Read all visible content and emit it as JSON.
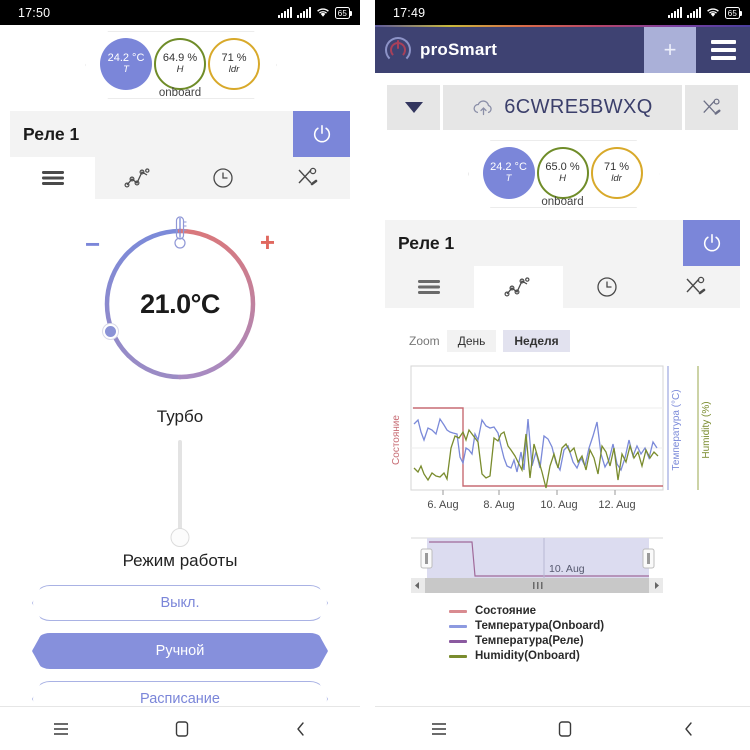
{
  "left": {
    "status": {
      "time": "17:50",
      "battery": "65",
      "signal_icon": "signal-bars-icon",
      "wifi_icon": "wifi-icon",
      "battery_icon": "battery-icon"
    },
    "gauges": {
      "caption": "onboard",
      "items": [
        {
          "value": "24.2 °C",
          "unit": "T",
          "style": "temperature",
          "color": "#7b86d9"
        },
        {
          "value": "64.9 %",
          "unit": "H",
          "style": "humidity",
          "color": "#6f8c28"
        },
        {
          "value": "71 %",
          "unit": "ldr",
          "style": "light",
          "color": "#d8a92a"
        }
      ]
    },
    "relay": {
      "title": "Реле 1",
      "power_icon": "power-icon",
      "power_color": "#7b86d9",
      "tabs": [
        {
          "icon": "sliders-icon",
          "active": true
        },
        {
          "icon": "chart-line-icon",
          "active": false
        },
        {
          "icon": "clock-icon",
          "active": false
        },
        {
          "icon": "tools-icon",
          "active": false
        }
      ]
    },
    "dial": {
      "value": "21.0°C",
      "minus_label": "−",
      "plus_label": "+",
      "thermometer_icon": "thermometer-icon",
      "cold_color": "#7b86d9",
      "hot_color": "#d9787c"
    },
    "turbo": {
      "label": "Турбо",
      "position_percent": 0
    },
    "mode": {
      "label": "Режим работы",
      "buttons": [
        {
          "label": "Выкл.",
          "active": false
        },
        {
          "label": "Ручной",
          "active": true
        },
        {
          "label": "Расписание",
          "active": false
        }
      ]
    },
    "navbar": {
      "recents_icon": "recents-icon",
      "home_icon": "home-icon",
      "back_icon": "back-icon"
    }
  },
  "right": {
    "status": {
      "time": "17:49",
      "battery": "65",
      "signal_icon": "signal-bars-icon",
      "wifi_icon": "wifi-icon",
      "battery_icon": "battery-icon"
    },
    "appbar": {
      "brand": "proSmart",
      "logo_icon": "prosmart-logo-icon",
      "add_label": "+",
      "menu_icon": "hamburger-menu-icon",
      "bg_color": "#3e4272",
      "add_bg_color": "#aab0d8"
    },
    "device": {
      "dropdown_icon": "chevron-down-icon",
      "cloud_icon": "cloud-upload-icon",
      "id": "6CWRE5BWXQ",
      "tools_icon": "tools-icon"
    },
    "gauges": {
      "caption": "onboard",
      "items": [
        {
          "value": "24.2 °C",
          "unit": "T",
          "style": "temperature",
          "color": "#7b86d9"
        },
        {
          "value": "65.0 %",
          "unit": "H",
          "style": "humidity",
          "color": "#6f8c28"
        },
        {
          "value": "71 %",
          "unit": "ldr",
          "style": "light",
          "color": "#d8a92a"
        }
      ]
    },
    "relay": {
      "title": "Реле 1",
      "power_icon": "power-icon",
      "power_color": "#7b86d9",
      "tabs": [
        {
          "icon": "sliders-icon",
          "active": false
        },
        {
          "icon": "chart-line-icon",
          "active": true
        },
        {
          "icon": "clock-icon",
          "active": false
        },
        {
          "icon": "tools-icon",
          "active": false
        }
      ]
    },
    "navbar": {
      "recents_icon": "recents-icon",
      "home_icon": "home-icon",
      "back_icon": "back-icon"
    }
  },
  "chart_data": {
    "type": "line",
    "title": "",
    "zoom_label": "Zoom",
    "zoom_buttons": [
      {
        "label": "День",
        "active": false
      },
      {
        "label": "Неделя",
        "active": true
      }
    ],
    "xlabel": "",
    "x_tick_labels": [
      "6. Aug",
      "8. Aug",
      "10. Aug",
      "12. Aug"
    ],
    "y_axes": [
      {
        "name": "Состояние",
        "position": "left",
        "color": "#c76b73"
      },
      {
        "name": "Температура (°C)",
        "position": "right",
        "color": "#7b8ad9"
      },
      {
        "name": "Humidity (%)",
        "position": "right-outer",
        "color": "#7a8c2e"
      }
    ],
    "grid": true,
    "legend_position": "bottom",
    "navigator": {
      "visible": true,
      "label": "10. Aug",
      "scroll_left_icon": "arrow-left-icon",
      "scroll_right_icon": "arrow-right-icon",
      "grip_icon": "grip-icon"
    },
    "series": [
      {
        "name": "Состояние",
        "color": "#c76b73",
        "type": "step",
        "values": [
          1,
          1,
          1,
          1,
          1,
          1,
          1,
          1,
          0,
          0,
          0,
          0,
          0,
          0,
          0,
          0,
          0,
          0,
          0,
          0,
          0,
          0,
          0,
          0,
          0,
          0,
          0,
          0,
          0,
          0,
          0,
          0,
          0,
          0,
          0,
          0,
          0,
          0,
          0,
          0
        ]
      },
      {
        "name": "Температура(Onboard)",
        "color": "#7b8ad9",
        "type": "line",
        "values": [
          26.0,
          25.0,
          23.2,
          22.4,
          24.5,
          24.0,
          23.6,
          26.5,
          25.3,
          24.4,
          24.0,
          23.8,
          23.6,
          19.4,
          18.0,
          17.0,
          16.4,
          18.0,
          21.6,
          20.4,
          27.0,
          25.8,
          25.4,
          25.6,
          24.4,
          22.0,
          19.4,
          17.6,
          17.0,
          18.4,
          15.6,
          20.0,
          16.2,
          28.0,
          17.4,
          20.0,
          16.6,
          24.0,
          23.4,
          21.4,
          17.6,
          16.0,
          20.6,
          21.6
        ]
      },
      {
        "name": "Температура(Реле)",
        "color": "#8b5aa0",
        "type": "line",
        "values": []
      },
      {
        "name": "Humidity(Onboard)",
        "color": "#7a8c2e",
        "type": "line",
        "values": [
          12.0,
          11.4,
          13.2,
          10.8,
          9.4,
          11.0,
          10.6,
          10.4,
          11.2,
          9.8,
          20.0,
          23.0,
          22.4,
          23.6,
          22.0,
          24.0,
          23.4,
          22.6,
          21.4,
          10.2,
          9.6,
          10.0,
          22.0,
          21.4,
          22.8,
          23.0,
          20.0,
          19.2,
          17.6,
          16.0,
          14.0,
          22.0,
          10.0,
          19.0,
          16.0,
          12.0,
          6.0,
          14.0,
          17.4,
          13.0,
          19.0,
          20.0,
          18.0,
          19.4
        ]
      }
    ],
    "legend": [
      {
        "label": "Состояние",
        "color": "#d98b90"
      },
      {
        "label": "Температура(Onboard)",
        "color": "#8d9ae0"
      },
      {
        "label": "Температура(Реле)",
        "color": "#8b5aa0"
      },
      {
        "label": "Humidity(Onboard)",
        "color": "#7a8c2e"
      }
    ]
  }
}
